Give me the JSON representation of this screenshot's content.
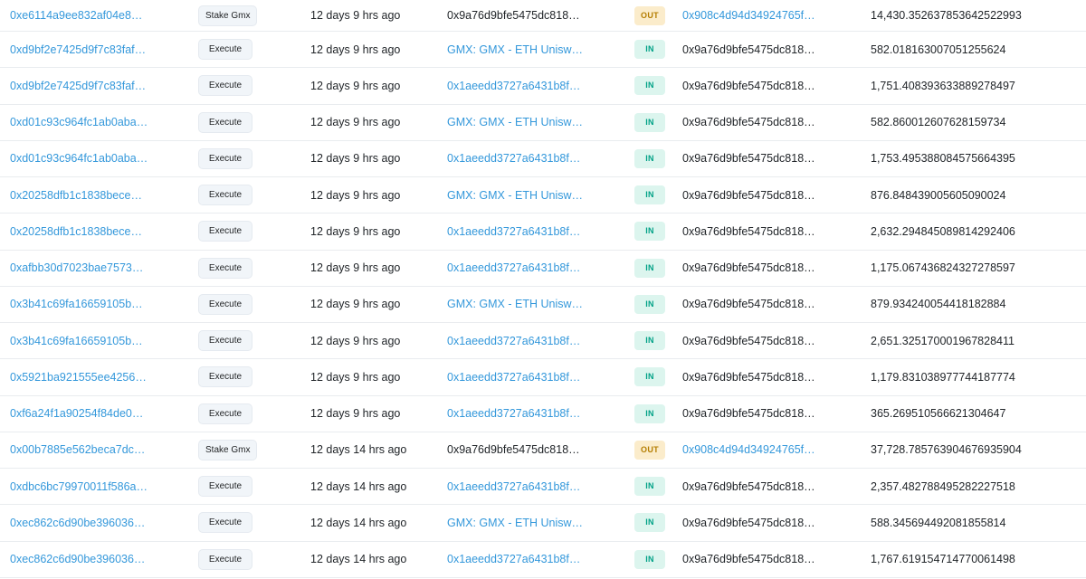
{
  "colors": {
    "link": "#3498db",
    "in_badge_bg": "#dcf5ee",
    "in_badge_text": "#00a186",
    "out_badge_bg": "#fbeccb",
    "out_badge_text": "#b47d00",
    "row_divider": "#e9ecef"
  },
  "rows": [
    {
      "hash": "0xe6114a9ee832af04e8…",
      "method": "Stake Gmx",
      "age": "12 days 9 hrs ago",
      "from": "0x9a76d9bfe5475dc818…",
      "from_link": false,
      "direction": "OUT",
      "to": "0x908c4d94d34924765f…",
      "to_link": true,
      "value": "14,430.352637853642522993"
    },
    {
      "hash": "0xd9bf2e7425d9f7c83faf…",
      "method": "Execute",
      "age": "12 days 9 hrs ago",
      "from": "GMX: GMX - ETH Unisw…",
      "from_link": true,
      "direction": "IN",
      "to": "0x9a76d9bfe5475dc818…",
      "to_link": false,
      "value": "582.018163007051255624"
    },
    {
      "hash": "0xd9bf2e7425d9f7c83faf…",
      "method": "Execute",
      "age": "12 days 9 hrs ago",
      "from": "0x1aeedd3727a6431b8f…",
      "from_link": true,
      "direction": "IN",
      "to": "0x9a76d9bfe5475dc818…",
      "to_link": false,
      "value": "1,751.408393633889278497"
    },
    {
      "hash": "0xd01c93c964fc1ab0aba…",
      "method": "Execute",
      "age": "12 days 9 hrs ago",
      "from": "GMX: GMX - ETH Unisw…",
      "from_link": true,
      "direction": "IN",
      "to": "0x9a76d9bfe5475dc818…",
      "to_link": false,
      "value": "582.860012607628159734"
    },
    {
      "hash": "0xd01c93c964fc1ab0aba…",
      "method": "Execute",
      "age": "12 days 9 hrs ago",
      "from": "0x1aeedd3727a6431b8f…",
      "from_link": true,
      "direction": "IN",
      "to": "0x9a76d9bfe5475dc818…",
      "to_link": false,
      "value": "1,753.495388084575664395"
    },
    {
      "hash": "0x20258dfb1c1838bece…",
      "method": "Execute",
      "age": "12 days 9 hrs ago",
      "from": "GMX: GMX - ETH Unisw…",
      "from_link": true,
      "direction": "IN",
      "to": "0x9a76d9bfe5475dc818…",
      "to_link": false,
      "value": "876.848439005605090024"
    },
    {
      "hash": "0x20258dfb1c1838bece…",
      "method": "Execute",
      "age": "12 days 9 hrs ago",
      "from": "0x1aeedd3727a6431b8f…",
      "from_link": true,
      "direction": "IN",
      "to": "0x9a76d9bfe5475dc818…",
      "to_link": false,
      "value": "2,632.294845089814292406"
    },
    {
      "hash": "0xafbb30d7023bae7573…",
      "method": "Execute",
      "age": "12 days 9 hrs ago",
      "from": "0x1aeedd3727a6431b8f…",
      "from_link": true,
      "direction": "IN",
      "to": "0x9a76d9bfe5475dc818…",
      "to_link": false,
      "value": "1,175.067436824327278597"
    },
    {
      "hash": "0x3b41c69fa16659105b…",
      "method": "Execute",
      "age": "12 days 9 hrs ago",
      "from": "GMX: GMX - ETH Unisw…",
      "from_link": true,
      "direction": "IN",
      "to": "0x9a76d9bfe5475dc818…",
      "to_link": false,
      "value": "879.934240054418182884"
    },
    {
      "hash": "0x3b41c69fa16659105b…",
      "method": "Execute",
      "age": "12 days 9 hrs ago",
      "from": "0x1aeedd3727a6431b8f…",
      "from_link": true,
      "direction": "IN",
      "to": "0x9a76d9bfe5475dc818…",
      "to_link": false,
      "value": "2,651.325170001967828411"
    },
    {
      "hash": "0x5921ba921555ee4256…",
      "method": "Execute",
      "age": "12 days 9 hrs ago",
      "from": "0x1aeedd3727a6431b8f…",
      "from_link": true,
      "direction": "IN",
      "to": "0x9a76d9bfe5475dc818…",
      "to_link": false,
      "value": "1,179.831038977744187774"
    },
    {
      "hash": "0xf6a24f1a90254f84de0…",
      "method": "Execute",
      "age": "12 days 9 hrs ago",
      "from": "0x1aeedd3727a6431b8f…",
      "from_link": true,
      "direction": "IN",
      "to": "0x9a76d9bfe5475dc818…",
      "to_link": false,
      "value": "365.269510566621304647"
    },
    {
      "hash": "0x00b7885e562beca7dc…",
      "method": "Stake Gmx",
      "age": "12 days 14 hrs ago",
      "from": "0x9a76d9bfe5475dc818…",
      "from_link": false,
      "direction": "OUT",
      "to": "0x908c4d94d34924765f…",
      "to_link": true,
      "value": "37,728.785763904676935904"
    },
    {
      "hash": "0xdbc6bc79970011f586a…",
      "method": "Execute",
      "age": "12 days 14 hrs ago",
      "from": "0x1aeedd3727a6431b8f…",
      "from_link": true,
      "direction": "IN",
      "to": "0x9a76d9bfe5475dc818…",
      "to_link": false,
      "value": "2,357.482788495282227518"
    },
    {
      "hash": "0xec862c6d90be396036…",
      "method": "Execute",
      "age": "12 days 14 hrs ago",
      "from": "GMX: GMX - ETH Unisw…",
      "from_link": true,
      "direction": "IN",
      "to": "0x9a76d9bfe5475dc818…",
      "to_link": false,
      "value": "588.345694492081855814"
    },
    {
      "hash": "0xec862c6d90be396036…",
      "method": "Execute",
      "age": "12 days 14 hrs ago",
      "from": "0x1aeedd3727a6431b8f…",
      "from_link": true,
      "direction": "IN",
      "to": "0x9a76d9bfe5475dc818…",
      "to_link": false,
      "value": "1,767.619154714770061498"
    }
  ]
}
